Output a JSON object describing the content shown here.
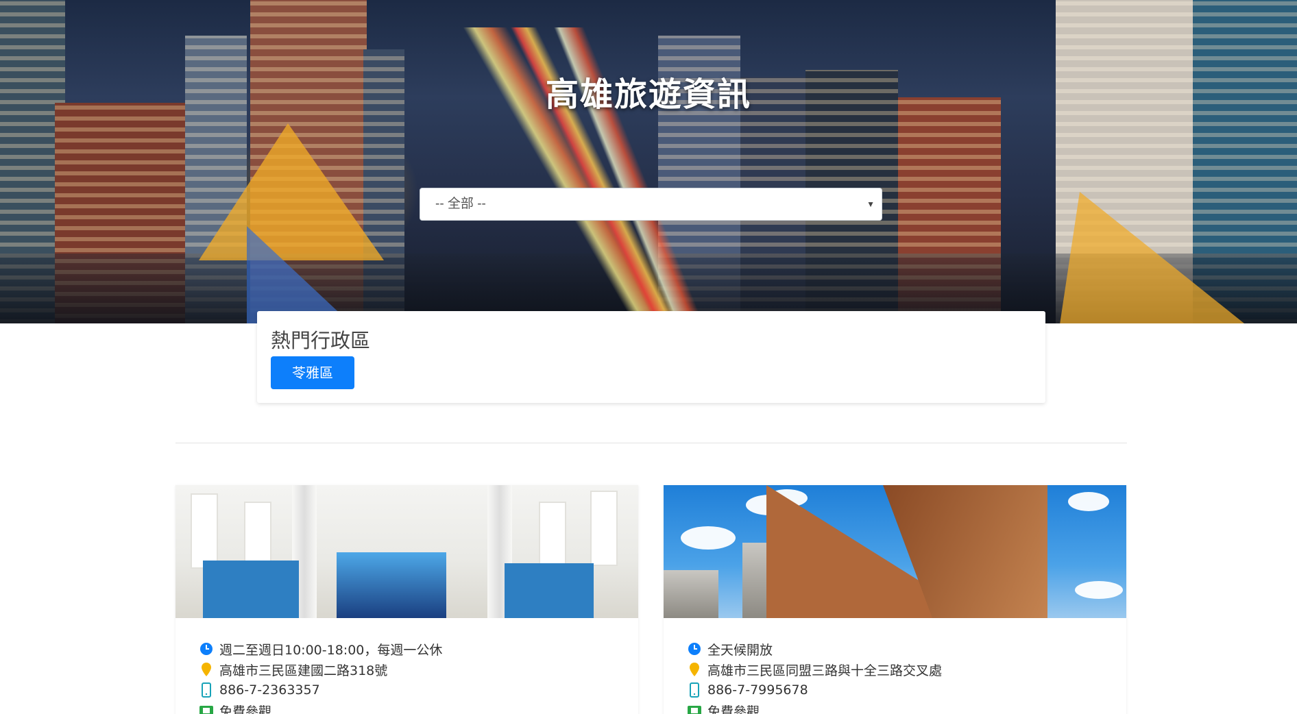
{
  "header": {
    "title": "高雄旅遊資訊"
  },
  "district_select": {
    "selected": "-- 全部 --"
  },
  "hot_districts": {
    "title": "熱門行政區",
    "items": [
      {
        "label": "苓雅區"
      }
    ]
  },
  "cards": [
    {
      "hours": "週二至週日10:00-18:00，每週一公休",
      "address": "高雄市三民區建國二路318號",
      "phone": "886-7-2363357",
      "ticket": "免費參觀"
    },
    {
      "hours": "全天候開放",
      "address": "高雄市三民區同盟三路與十全三路交叉處",
      "phone": "886-7-7995678",
      "ticket": "免費參觀"
    }
  ],
  "icons": {
    "hours": "clock-icon",
    "address": "map-pin-icon",
    "phone": "mobile-phone-icon",
    "ticket": "ticket-icon"
  },
  "colors": {
    "primary": "#0d7ffb",
    "clock": "#0d7ffb",
    "pin": "#f5b400",
    "phone": "#17a2b8",
    "ticket": "#28a745"
  }
}
